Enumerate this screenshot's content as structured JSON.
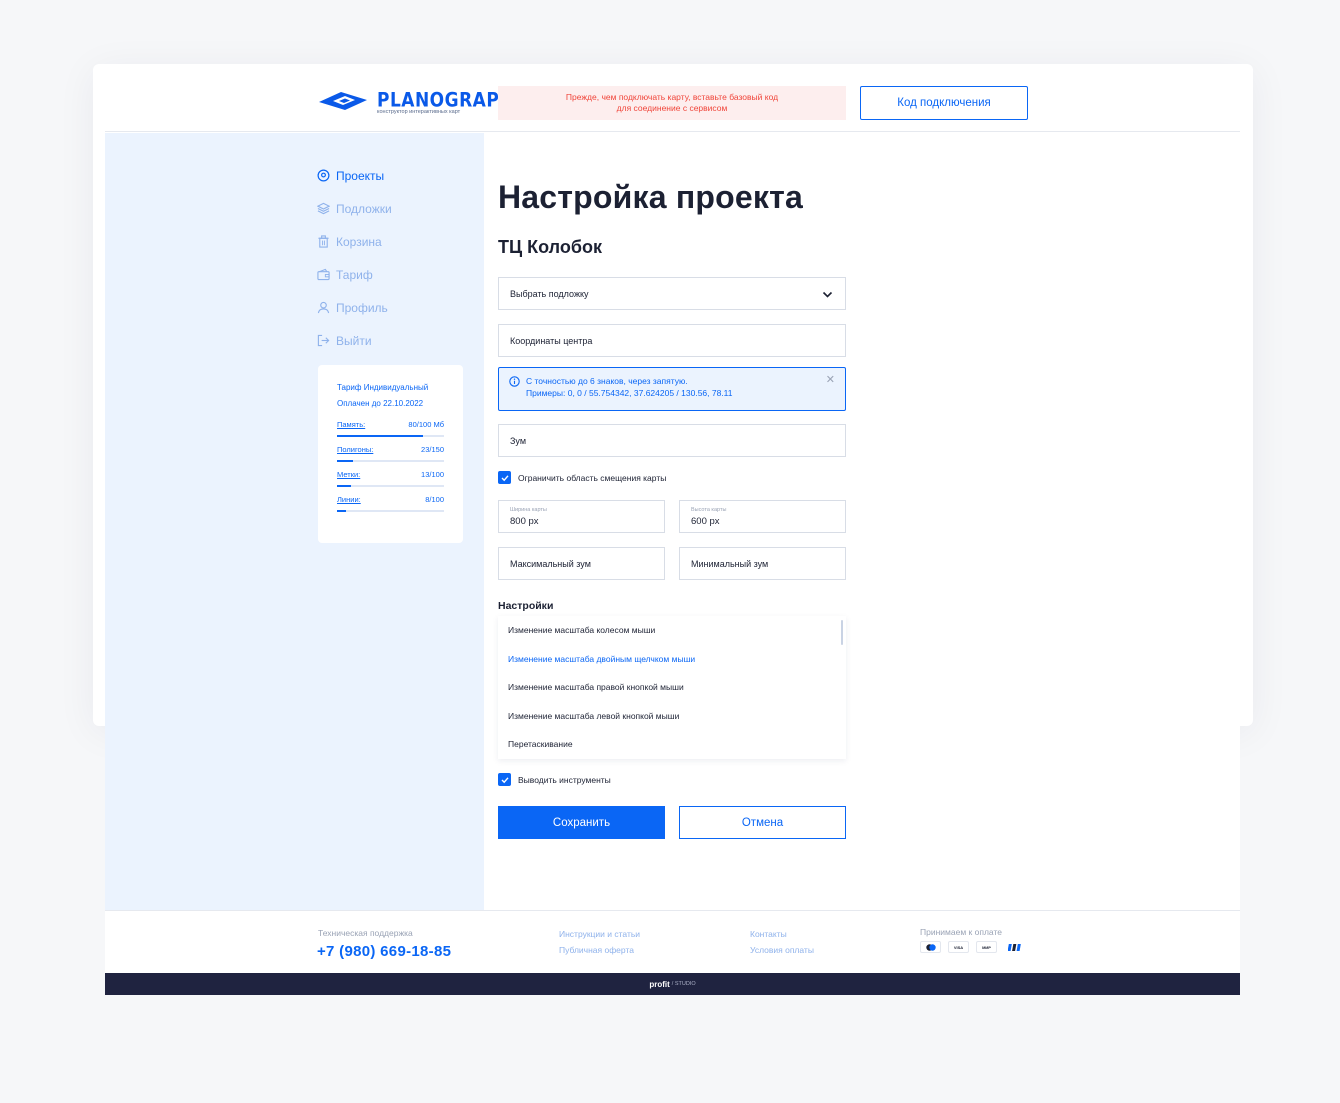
{
  "brand": {
    "name": "PLANOGRAPH",
    "tagline": "конструктор интерактивных карт",
    "color": "#0a59e8"
  },
  "header": {
    "alert_line1": "Прежде, чем подключать карту, вставьте базовый код",
    "alert_line2": "для соединение с сервисом",
    "code_button": "Код подключения"
  },
  "sidebar": {
    "items": [
      {
        "label": "Проекты",
        "icon": "location-pin-icon",
        "active": true
      },
      {
        "label": "Подложки",
        "icon": "layers-icon",
        "active": false
      },
      {
        "label": "Корзина",
        "icon": "trash-icon",
        "active": false
      },
      {
        "label": "Тариф",
        "icon": "wallet-icon",
        "active": false
      },
      {
        "label": "Профиль",
        "icon": "user-icon",
        "active": false
      },
      {
        "label": "Выйти",
        "icon": "logout-icon",
        "active": false
      }
    ],
    "tariff": {
      "plan": "Тариф Индивидуальный",
      "paid_until": "Оплачен до 22.10.2022",
      "stats": [
        {
          "label": "Память:",
          "value": "80/100 Мб",
          "fraction": 0.8
        },
        {
          "label": "Полигоны:",
          "value": "23/150",
          "fraction": 0.15
        },
        {
          "label": "Метки:",
          "value": "13/100",
          "fraction": 0.13
        },
        {
          "label": "Линии:",
          "value": "8/100",
          "fraction": 0.08
        }
      ]
    }
  },
  "main": {
    "title": "Настройка проекта",
    "subtitle": "ТЦ Колобок",
    "select_substrate": "Выбрать подложку",
    "center_coords": "Координаты центра",
    "info_line1": "С точностью до 6 знаков, через запятую.",
    "info_line2": "Примеры: 0, 0 / 55.754342, 37.624205 / 130.56, 78.11",
    "zoom": "Зум",
    "limit_area": "Ограничить область смещения карты",
    "map_width_label": "Ширина карты",
    "map_width": "800 px",
    "map_height_label": "Высота карты",
    "map_height": "600 px",
    "max_zoom": "Максимальный зум",
    "min_zoom": "Минимальный зум",
    "settings_title": "Настройки",
    "settings": [
      {
        "label": "Изменение масштаба колесом мыши",
        "selected": false
      },
      {
        "label": "Изменение масштаба двойным щелчком мыши",
        "selected": true
      },
      {
        "label": "Изменение масштаба правой кнопкой мыши",
        "selected": false
      },
      {
        "label": "Изменение масштаба левой кнопкой мыши",
        "selected": false
      },
      {
        "label": "Перетаскивание",
        "selected": false
      }
    ],
    "show_tools": "Выводить инструменты",
    "save": "Сохранить",
    "cancel": "Отмена"
  },
  "footer": {
    "support_label": "Техническая поддержка",
    "phone": "+7 (980) 669-18-85",
    "links": [
      "Инструкции и статьи",
      "Публичная оферта",
      "Контакты",
      "Условия оплаты"
    ],
    "payments_label": "Принимаем к оплате",
    "payment_methods": [
      "mastercard-icon",
      "VISA",
      "МИР",
      "sbp-icon"
    ],
    "studio_brand": "profit",
    "studio_suffix": "/ STUDIO"
  },
  "colors": {
    "accent": "#0a66f5",
    "sidebar_bg": "#ebf3fe",
    "alert_bg": "#fdeeee",
    "alert_text": "#f0453a",
    "bottom_bar": "#1f2340"
  }
}
